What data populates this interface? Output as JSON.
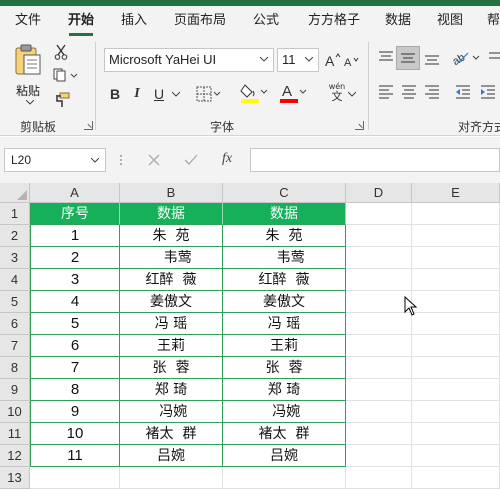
{
  "menu": {
    "tabs": [
      {
        "label": "文件"
      },
      {
        "label": "开始"
      },
      {
        "label": "插入"
      },
      {
        "label": "页面布局"
      },
      {
        "label": "公式"
      },
      {
        "label": "方方格子"
      },
      {
        "label": "数据"
      },
      {
        "label": "视图"
      },
      {
        "label": "帮助"
      }
    ],
    "active_tab": "开始"
  },
  "ribbon": {
    "clipboard": {
      "paste_label": "粘贴",
      "group_label": "剪贴板"
    },
    "font": {
      "font_name": "Microsoft YaHei UI",
      "font_size": "11",
      "bold": "B",
      "italic": "I",
      "underline": "U",
      "phonetic_top": "wén",
      "phonetic_bottom": "文",
      "group_label": "字体",
      "fill_color": "#ffff00",
      "font_color": "#ff0000"
    },
    "alignment": {
      "group_label": "对齐方式"
    }
  },
  "formula_bar": {
    "name_box": "L20",
    "formula": "",
    "fx_label": "fx"
  },
  "sheet": {
    "columns": [
      "A",
      "B",
      "C",
      "D",
      "E"
    ],
    "rows": [
      "1",
      "2",
      "3",
      "4",
      "5",
      "6",
      "7",
      "8",
      "9",
      "10",
      "11",
      "12",
      "13"
    ],
    "header": [
      "序号",
      "数据",
      "数据"
    ],
    "data": [
      [
        "1",
        "朱  苑",
        "朱  苑"
      ],
      [
        "2",
        "   韦莺",
        "   韦莺"
      ],
      [
        "3",
        "红醉  薇",
        "红醉  薇"
      ],
      [
        "4",
        "姜傲文",
        "姜傲文"
      ],
      [
        "5",
        "冯 瑶",
        "冯 瑶"
      ],
      [
        "6",
        "王莉",
        "王莉"
      ],
      [
        "7",
        "张  蓉",
        "张  蓉"
      ],
      [
        "8",
        "郑 琦",
        "郑 琦"
      ],
      [
        "9",
        " 冯婉",
        " 冯婉"
      ],
      [
        "10",
        "褚太  群",
        "褚太  群"
      ],
      [
        "11",
        "吕婉",
        "吕婉"
      ]
    ],
    "header_fill": "#17b05a",
    "table_border": "#2ea05a"
  }
}
